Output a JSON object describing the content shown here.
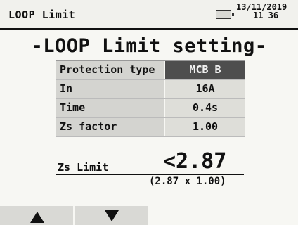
{
  "titlebar": {
    "title": "LOOP Limit",
    "battery_icon": "battery-icon",
    "date": "13/11/2019",
    "time": "11 36"
  },
  "heading": "-LOOP Limit setting-",
  "settings": {
    "rows": [
      {
        "label": "Protection type",
        "value": "MCB B",
        "selected": true
      },
      {
        "label": "In",
        "value": "16A",
        "selected": false
      },
      {
        "label": "Time",
        "value": "0.4s",
        "selected": false
      },
      {
        "label": "Zs factor",
        "value": "1.00",
        "selected": false
      }
    ]
  },
  "result": {
    "label": "Zs Limit",
    "value": "<2.87",
    "formula": "(2.87 x 1.00)"
  },
  "softkeys": [
    {
      "icon": "arrow-up-icon"
    },
    {
      "icon": "arrow-down-icon"
    },
    {
      "icon": ""
    },
    {
      "icon": ""
    }
  ],
  "colors": {
    "selected_bg": "#4e4e4e",
    "row_bg": "#deded9",
    "screen_bg": "#f7f7f3"
  }
}
